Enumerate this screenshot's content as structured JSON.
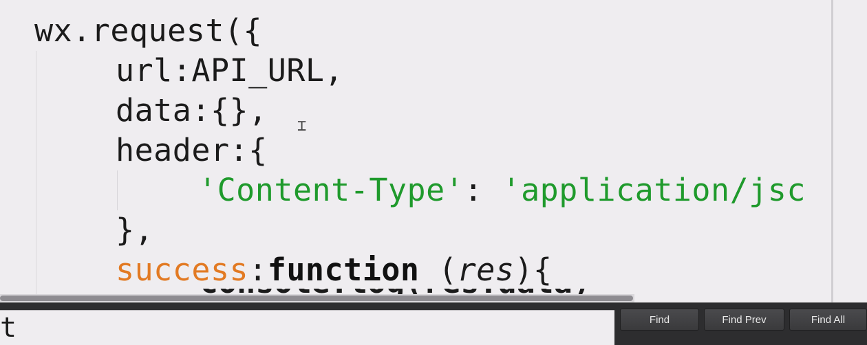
{
  "editor": {
    "lines": [
      {
        "text": "wx.request({"
      },
      {
        "text": "url:API_URL,"
      },
      {
        "text": "data:{},"
      },
      {
        "text": "header:{"
      },
      {
        "key": "'Content-Type'",
        "sep": ": ",
        "value": "'application/jsc"
      },
      {
        "text": "},"
      },
      {
        "key": "success",
        "sep": ":",
        "kw": "function",
        "open": " (",
        "param": "res",
        "close": "){"
      }
    ],
    "clipped_line_text": "console.log(res.data)"
  },
  "find_bar": {
    "input_value": "t",
    "buttons": {
      "find": "Find",
      "find_prev": "Find Prev",
      "find_all": "Find All"
    }
  },
  "colors": {
    "string": "#1f9a2c",
    "property": "#e27a23",
    "background": "#efedf0"
  }
}
